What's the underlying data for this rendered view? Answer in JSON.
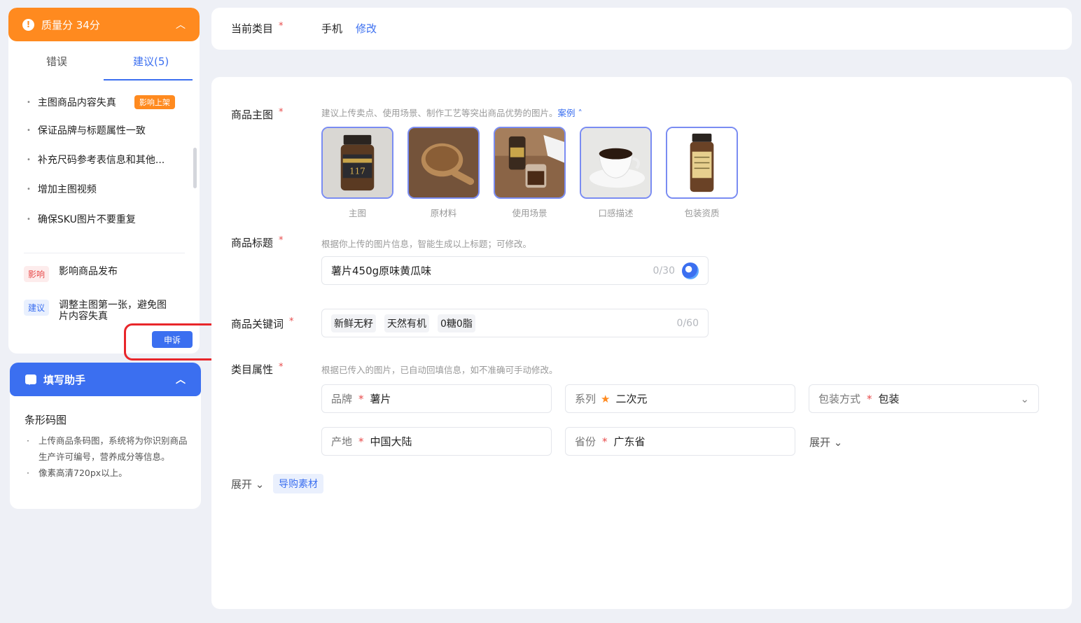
{
  "quality": {
    "title": "质量分 34分"
  },
  "tabs": {
    "error": "错误",
    "suggestion": "建议(5)"
  },
  "suggestions": [
    {
      "text": "主图商品内容失真",
      "tag": "影响上架"
    },
    {
      "text": "保证品牌与标题属性一致"
    },
    {
      "text": "补充尺码参考表信息和其他..."
    },
    {
      "text": "增加主图视频"
    },
    {
      "text": "确保SKU图片不要重复"
    }
  ],
  "impact": {
    "badge": "影响",
    "text": "影响商品发布"
  },
  "advice": {
    "badge": "建议",
    "text": "调整主图第一张，避免图片内容失真"
  },
  "appeal_button": "申诉",
  "helper": {
    "title": "填写助手",
    "section_title": "条形码图",
    "tips": [
      "上传商品条码图，系统将为你识别商品生产许可编号，营养成分等信息。",
      "像素高清720px以上。"
    ]
  },
  "category": {
    "label": "当前类目",
    "value": "手机",
    "edit": "修改"
  },
  "main_image": {
    "label": "商品主图",
    "hint": "建议上传卖点、使用场景、制作工艺等突出商品优势的图片。",
    "hint_link": "案例",
    "images": [
      {
        "caption": "主图"
      },
      {
        "caption": "原材料"
      },
      {
        "caption": "使用场景"
      },
      {
        "caption": "口感描述"
      },
      {
        "caption": "包装资质"
      }
    ]
  },
  "product_title": {
    "label": "商品标题",
    "hint": "根据你上传的图片信息，智能生成以上标题；可修改。",
    "value": "薯片450g原味黄瓜味",
    "counter": "0/30"
  },
  "keywords": {
    "label": "商品关键词",
    "items": [
      "新鲜无籽",
      "天然有机",
      "0糖0脂"
    ],
    "counter": "0/60"
  },
  "attributes": {
    "label": "类目属性",
    "hint": "根据已传入的图片，已自动回填信息，如不准确可手动修改。",
    "brand": {
      "label": "品牌",
      "value": "薯片"
    },
    "series": {
      "label": "系列",
      "value": "二次元"
    },
    "packaging": {
      "label": "包装方式",
      "value": "包装"
    },
    "origin": {
      "label": "产地",
      "value": "中国大陆"
    },
    "province": {
      "label": "省份",
      "value": "广东省"
    },
    "expand": "展开"
  },
  "footer": {
    "expand": "展开",
    "guide_button": "导购素材"
  },
  "colors": {
    "orange": "#ff8a1f",
    "blue": "#3b6ff0",
    "red": "#e8262a"
  }
}
